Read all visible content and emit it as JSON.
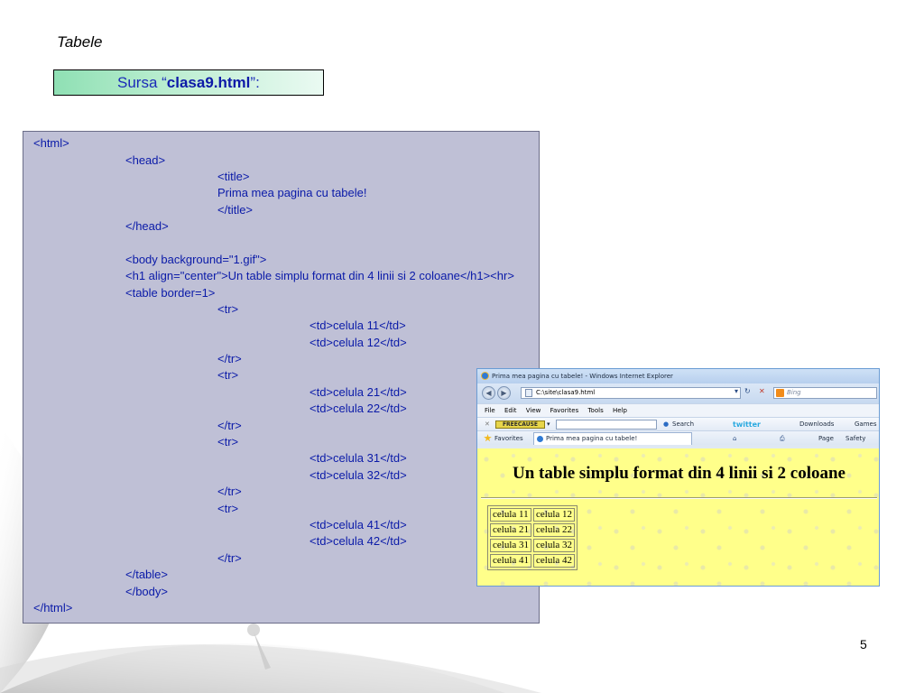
{
  "slide": {
    "title": "Tabele",
    "source_prefix": "Sursa “",
    "source_file": "clasa9.html",
    "source_suffix": "”:",
    "page_number": "5"
  },
  "code_lines": [
    "<html>",
    "<head>",
    "<title>",
    "Prima mea pagina cu tabele!",
    "</title>",
    "</head>",
    "<body background=\"1.gif\">",
    "<h1 align=\"center\">Un table simplu format din 4 linii si 2 coloane</h1><hr>",
    "<table border=1>",
    "<tr>",
    "<td>celula 11</td>",
    "<td>celula 12</td>",
    "</tr>",
    "<tr>",
    "<td>celula 21</td>",
    "<td>celula 22</td>",
    "</tr>",
    "<tr>",
    "<td>celula 31</td>",
    "<td>celula 32</td>",
    "</tr>",
    "<tr>",
    "<td>celula 41</td>",
    "<td>celula 42</td>",
    "</tr>",
    "</table>",
    "</body>",
    "</html>"
  ],
  "browser": {
    "window_title": "Prima mea pagina cu tabele! - Windows Internet Explorer",
    "address": "C:\\site\\clasa9.html",
    "search_placeholder": "Bing",
    "menu": [
      "File",
      "Edit",
      "View",
      "Favorites",
      "Tools",
      "Help"
    ],
    "toolbar": {
      "logo_text": "FREECAUSE",
      "search_label": "Search",
      "twitter_label": "twitter",
      "downloads_label": "Downloads",
      "games_label": "Games"
    },
    "favorites_label": "Favorites",
    "tab_title": "Prima mea pagina cu tabele!",
    "command_bar": {
      "page_label": "Page",
      "safety_label": "Safety"
    },
    "page_heading": "Un table simplu format din 4 linii si 2 coloane",
    "table_rows": [
      [
        "celula 11",
        "celula 12"
      ],
      [
        "celula 21",
        "celula 22"
      ],
      [
        "celula 31",
        "celula 32"
      ],
      [
        "celula 41",
        "celula 42"
      ]
    ],
    "colors": {
      "content_background": "#ffff8a",
      "frame": "#6a9cd4"
    }
  },
  "colors": {
    "code_panel": "#bfc0d6",
    "code_text": "#0a1aa8",
    "source_box_gradient_start": "#8fe0b4"
  }
}
